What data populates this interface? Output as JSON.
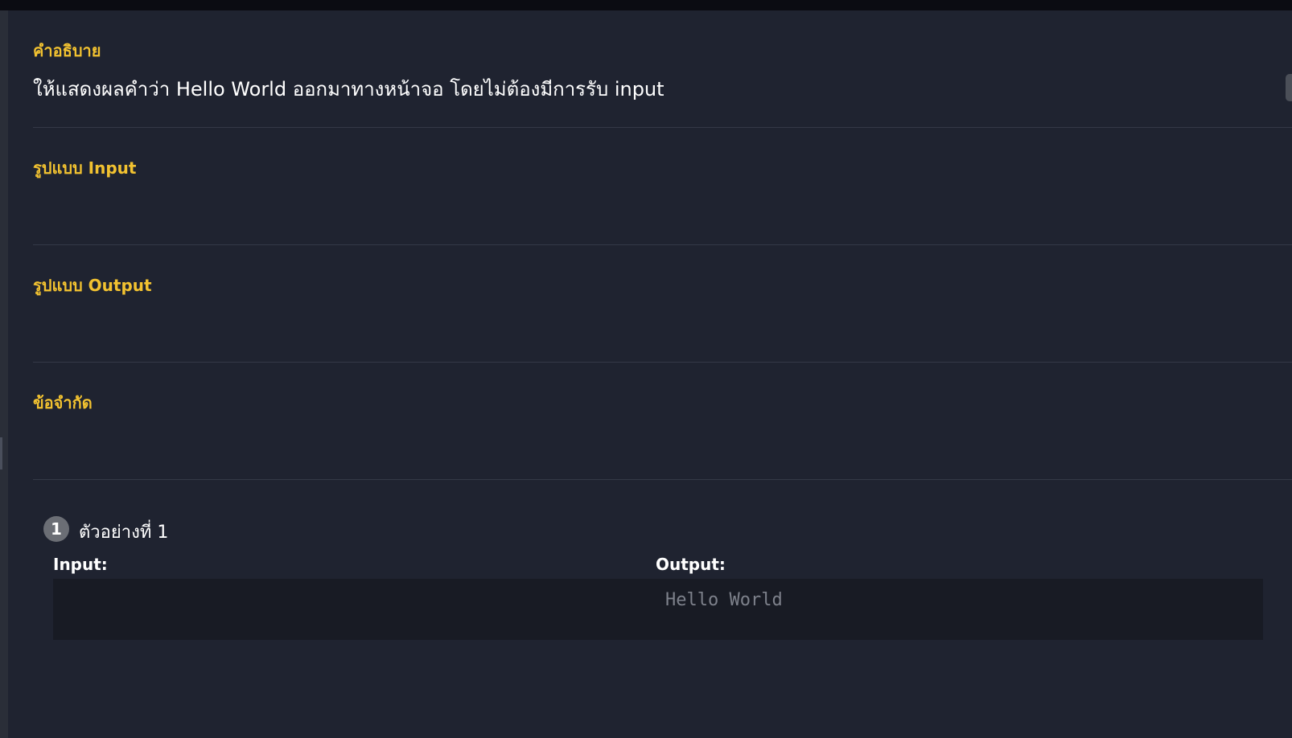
{
  "sections": [
    {
      "title": "คำอธิบาย",
      "text": "ให้แสดงผลคำว่า Hello World ออกมาทางหน้าจอ โดยไม่ต้องมีการรับ input"
    },
    {
      "title": "รูปแบบ Input",
      "text": ""
    },
    {
      "title": "รูปแบบ Output",
      "text": ""
    },
    {
      "title": "ข้อจำกัด",
      "text": ""
    }
  ],
  "example": {
    "number": "1",
    "title": "ตัวอย่างที่ 1",
    "input_label": "Input:",
    "input_value": "",
    "output_label": "Output:",
    "output_value": "Hello World"
  },
  "colors": {
    "background": "#1f2330",
    "section_title": "#f2c230",
    "text": "#ffffff",
    "code_box": "#181b24",
    "code_text": "#7d818b"
  }
}
